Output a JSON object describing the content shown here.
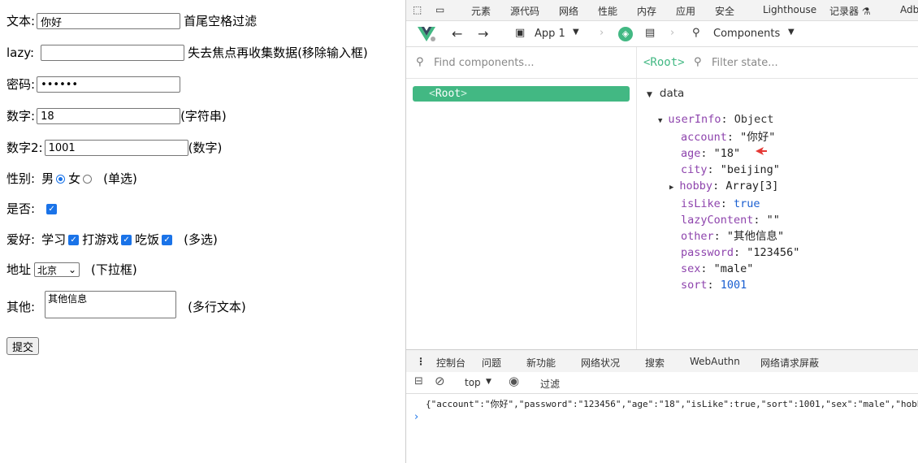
{
  "form": {
    "text_label": "文本:",
    "text_value": "你好",
    "text_note": "首尾空格过滤",
    "lazy_label": "lazy:",
    "lazy_value": "",
    "lazy_note": "失去焦点再收集数据(移除输入框)",
    "password_label": "密码:",
    "password_value": "••••••",
    "number_label": "数字:",
    "number_value": "18",
    "number_note": "(字符串)",
    "number2_label": "数字2:",
    "number2_value": "1001",
    "number2_note": "(数字)",
    "gender_label": "性别:",
    "gender_male": "男",
    "gender_female": "女",
    "gender_note": "(单选)",
    "yesno_label": "是否:",
    "hobby_label": "爱好:",
    "hobby_study": "学习",
    "hobby_game": "打游戏",
    "hobby_eat": "吃饭",
    "hobby_note": "(多选)",
    "city_label": "地址",
    "city_selected": "北京",
    "city_note": "(下拉框)",
    "other_label": "其他:",
    "other_value": "其他信息",
    "other_note": "(多行文本)",
    "submit_label": "提交"
  },
  "devtools": {
    "tabs": [
      "元素",
      "源代码",
      "网络",
      "性能",
      "内存",
      "应用",
      "安全",
      "Lighthouse",
      "记录器 ⚗",
      "Adb"
    ],
    "app_name": "App 1",
    "components_label": "Components",
    "find_placeholder": "Find components...",
    "root_tag": "<Root>",
    "filter_placeholder": "Filter state...",
    "root_item": "Root",
    "data_label": "data",
    "userinfo_key": "userInfo",
    "userinfo_type": "Object",
    "fields": [
      {
        "key": "account",
        "value": "\"你好\"",
        "kind": "s"
      },
      {
        "key": "age",
        "value": "\"18\"",
        "kind": "s"
      },
      {
        "key": "city",
        "value": "\"beijing\"",
        "kind": "s"
      },
      {
        "key": "hobby",
        "value": "Array[3]",
        "kind": "s"
      },
      {
        "key": "isLike",
        "value": "true",
        "kind": "b"
      },
      {
        "key": "lazyContent",
        "value": "\"\"",
        "kind": "s"
      },
      {
        "key": "other",
        "value": "\"其他信息\"",
        "kind": "s"
      },
      {
        "key": "password",
        "value": "\"123456\"",
        "kind": "s"
      },
      {
        "key": "sex",
        "value": "\"male\"",
        "kind": "s"
      },
      {
        "key": "sort",
        "value": "1001",
        "kind": "n"
      }
    ],
    "console_tabs": [
      "控制台",
      "问题",
      "新功能",
      "网络状况",
      "搜索",
      "WebAuthn",
      "网络请求屏蔽"
    ],
    "context": "top",
    "filter_label": "过滤",
    "console_output": "{\"account\":\"你好\",\"password\":\"123456\",\"age\":\"18\",\"isLike\":true,\"sort\":1001,\"sex\":\"male\",\"hobb",
    "prompt": "›"
  },
  "colors": {
    "vue_green": "#42b883",
    "accent_blue": "#1a73e8",
    "key_purple": "#8e44ad"
  }
}
